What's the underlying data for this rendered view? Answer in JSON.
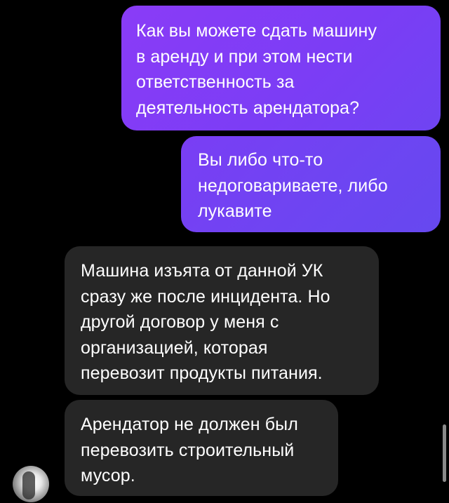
{
  "chat": {
    "messages": [
      {
        "direction": "outgoing",
        "text": "Как вы можете сдать машину\nв аренду и при этом нести\nответственность за\nдеятельность арендатора?"
      },
      {
        "direction": "outgoing",
        "text": "Вы либо что-то\nнедоговариваете, либо\nлукавите"
      },
      {
        "direction": "incoming",
        "text": "Машина изъята от данной УК\nсразу же после инцидента. Но\nдругой договор у меня с\nорганизацией, которая\nперевозит продукты питания."
      },
      {
        "direction": "incoming",
        "text": "Арендатор не должен был\nперевозить строительный\nмусор."
      }
    ]
  },
  "colors": {
    "background": "#000000",
    "outgoing_bubble": "#7b3df5",
    "incoming_bubble": "#262626",
    "text": "#ffffff"
  }
}
